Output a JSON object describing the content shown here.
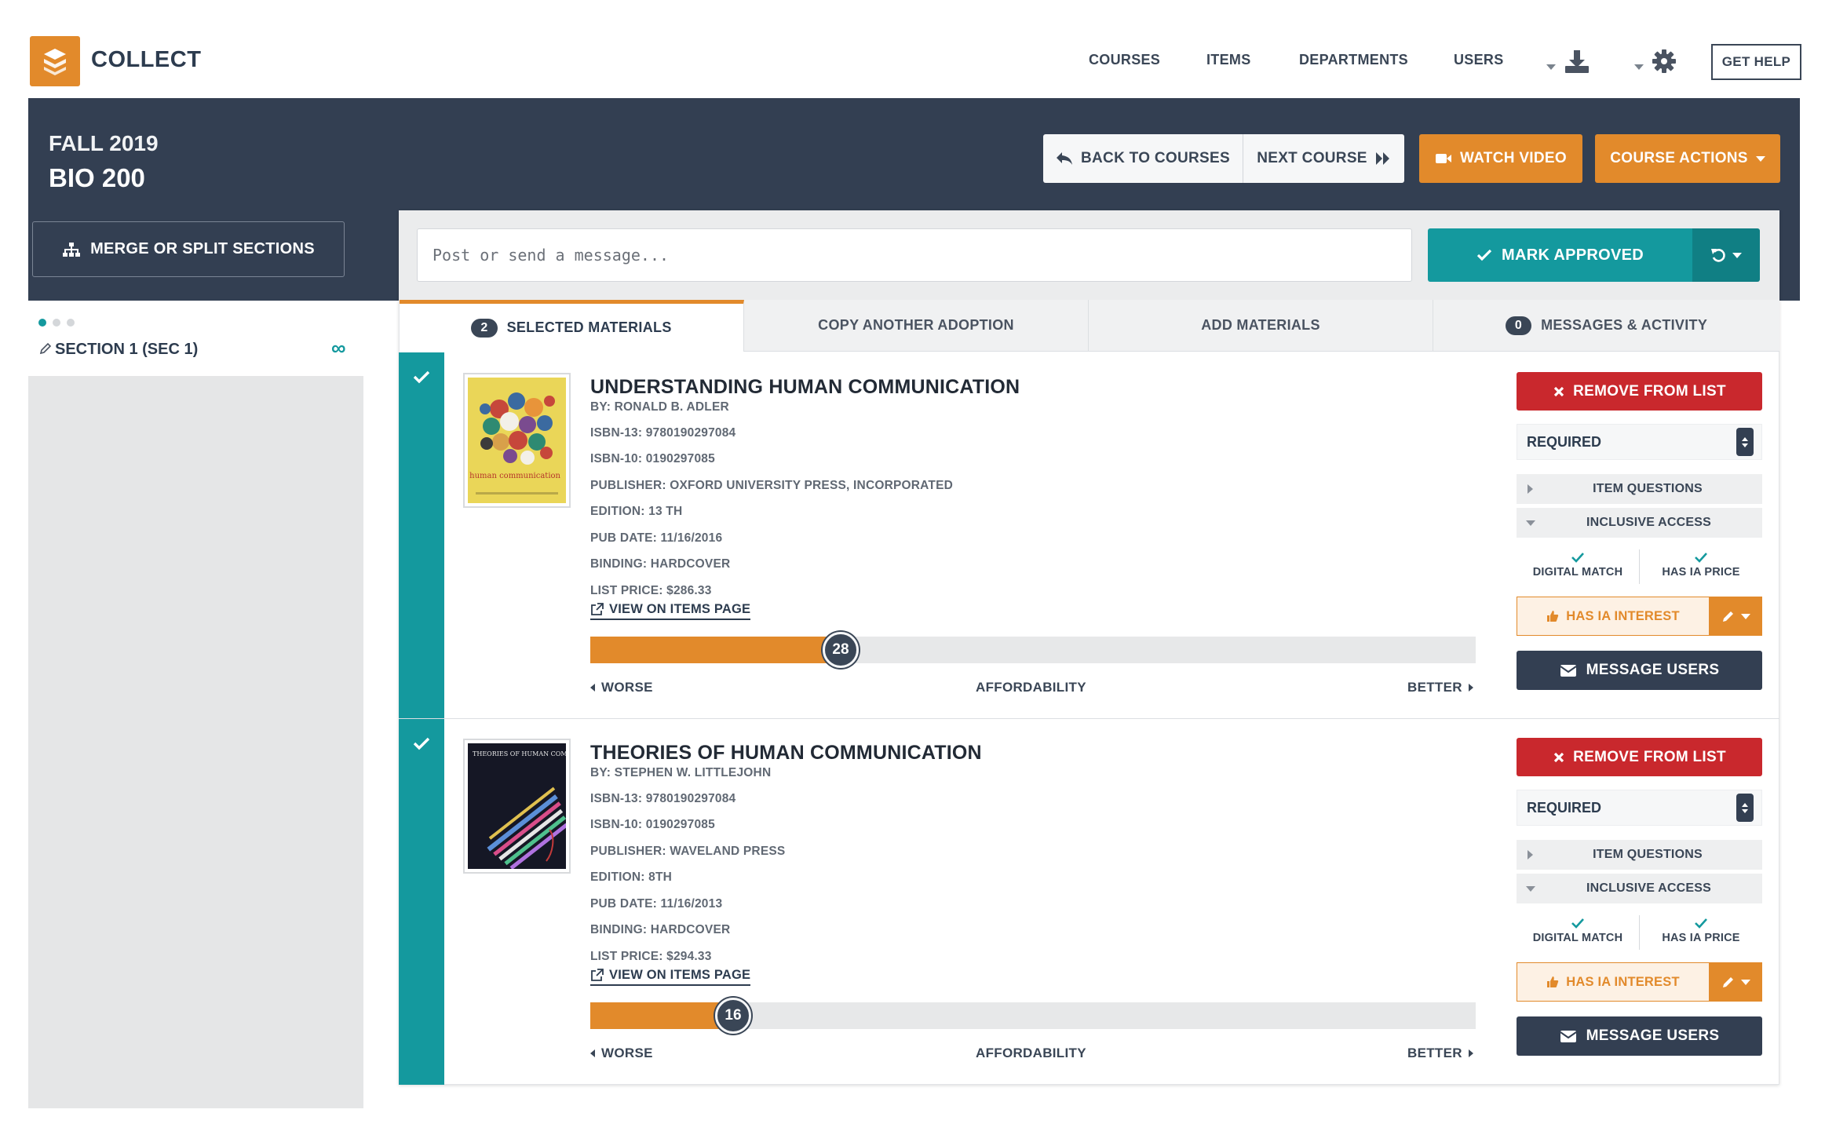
{
  "app": {
    "name": "COLLECT"
  },
  "nav": {
    "courses": "COURSES",
    "items": "ITEMS",
    "departments": "DEPARTMENTS",
    "users": "USERS",
    "get_help": "GET HELP"
  },
  "header": {
    "term": "FALL 2019",
    "course": "BIO 200",
    "back_label": "BACK TO COURSES",
    "next_label": "NEXT COURSE",
    "watch_label": "WATCH VIDEO",
    "actions_label": "COURSE ACTIONS",
    "merge_label": "MERGE OR SPLIT SECTIONS"
  },
  "message": {
    "placeholder": "Post or send a message..."
  },
  "approve": {
    "label": "MARK APPROVED"
  },
  "tabs": [
    {
      "label": "SELECTED MATERIALS",
      "count": "2"
    },
    {
      "label": "COPY ANOTHER ADOPTION"
    },
    {
      "label": "ADD MATERIALS"
    },
    {
      "label": "MESSAGES & ACTIVITY",
      "count": "0"
    }
  ],
  "sidebar": {
    "section": "SECTION 1 (SEC 1)",
    "infinity": "∞"
  },
  "items": [
    {
      "title": "UNDERSTANDING HUMAN COMMUNICATION",
      "author": "BY: RONALD B. ADLER",
      "isbn13": "ISBN-13: 9780190297084",
      "isbn10": "ISBN-10: 0190297085",
      "publisher": "PUBLISHER: OXFORD UNIVERSITY PRESS, INCORPORATED",
      "edition": "EDITION: 13 TH",
      "pub_date": "PUB DATE: 11/16/2016",
      "binding": "BINDING: HARDCOVER",
      "list_price": "LIST PRICE: $286.33",
      "view_link": "VIEW ON ITEMS PAGE",
      "affordability": "28",
      "affordability_fraction": 0.283,
      "cover_text": "understanding human communication"
    },
    {
      "title": "THEORIES OF HUMAN COMMUNICATION",
      "author": "BY: STEPHEN W. LITTLEJOHN",
      "isbn13": "ISBN-13: 9780190297084",
      "isbn10": "ISBN-10: 0190297085",
      "publisher": "PUBLISHER: WAVELAND PRESS",
      "edition": "EDITION: 8TH",
      "pub_date": "PUB DATE: 11/16/2013",
      "binding": "BINDING: HARDCOVER",
      "list_price": "LIST PRICE: $294.33",
      "view_link": "VIEW ON ITEMS PAGE",
      "affordability": "16",
      "affordability_fraction": 0.161,
      "cover_text": "THEORIES OF HUMAN COMMUNICATION"
    }
  ],
  "item_controls": {
    "remove": "REMOVE FROM LIST",
    "required": "REQUIRED",
    "item_questions": "ITEM QUESTIONS",
    "inclusive_access": "INCLUSIVE ACCESS",
    "digital_match": "DIGITAL MATCH",
    "has_ia_price": "HAS IA PRICE",
    "has_ia_interest": "HAS IA INTEREST",
    "message_users": "MESSAGE USERS",
    "worse": "WORSE",
    "affordability": "AFFORDABILITY",
    "better": "BETTER"
  },
  "colors": {
    "brand_orange": "#e28a2b",
    "header_navy": "#333f52",
    "teal": "#14999e",
    "danger_red": "#c9282d"
  }
}
